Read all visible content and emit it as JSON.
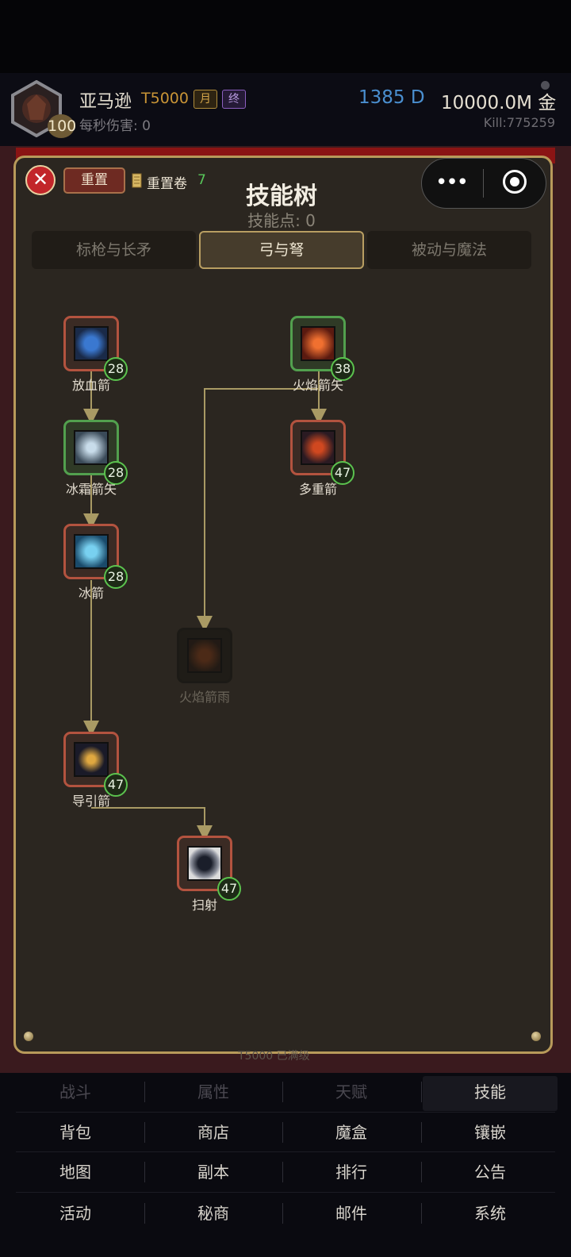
{
  "player": {
    "name": "亚马逊",
    "tier": "T5000",
    "tags": [
      "月",
      "终"
    ],
    "level": "100",
    "dps_label": "每秒伤害: 0",
    "diamonds": "1385 D",
    "gold": "10000.0M 金",
    "kills": "Kill:775259"
  },
  "panel": {
    "reset_label": "重置",
    "scroll_label": "重置卷",
    "scroll_count": "7",
    "title": "技能树",
    "points_label": "技能点: 0",
    "close_icon": "close-icon",
    "more_icon": "more-dots-icon",
    "target_icon": "target-icon",
    "footnote": "T5000 已满级"
  },
  "tabs": [
    {
      "label": "标枪与长矛",
      "active": false
    },
    {
      "label": "弓与弩",
      "active": true
    },
    {
      "label": "被动与魔法",
      "active": false
    }
  ],
  "skills": [
    {
      "name": "放血箭",
      "level": "28",
      "state": "red",
      "icon": "bleed-arrow-icon",
      "color": "#3a78d0"
    },
    {
      "name": "冰霜箭矢",
      "level": "28",
      "state": "green",
      "icon": "frost-arrow-icon",
      "color": "#9ab8d0"
    },
    {
      "name": "冰箭",
      "level": "28",
      "state": "red",
      "icon": "ice-arrow-icon",
      "color": "#58b8e8"
    },
    {
      "name": "导引箭",
      "level": "47",
      "state": "red",
      "icon": "guided-arrow-icon",
      "color": "#c89436"
    },
    {
      "name": "火焰箭矢",
      "level": "38",
      "state": "green",
      "icon": "fire-arrow-icon",
      "color": "#d84a1c"
    },
    {
      "name": "多重箭",
      "level": "47",
      "state": "red",
      "icon": "multishot-icon",
      "color": "#c8441e"
    },
    {
      "name": "火焰箭雨",
      "level": "",
      "state": "dim",
      "icon": "fire-rain-icon",
      "color": "#6a3418"
    },
    {
      "name": "扫射",
      "level": "47",
      "state": "red",
      "icon": "strafe-icon",
      "color": "#8a8e9a"
    }
  ],
  "nav": [
    [
      "战斗",
      "属性",
      "天赋",
      "技能"
    ],
    [
      "背包",
      "商店",
      "魔盒",
      "镶嵌"
    ],
    [
      "地图",
      "副本",
      "排行",
      "公告"
    ],
    [
      "活动",
      "秘商",
      "邮件",
      "系统"
    ]
  ],
  "colors": {
    "accent_gold": "#b89a5a",
    "learned_green": "#52a04e",
    "available_red": "#b3533f",
    "panel_bg": "#2b2620"
  }
}
